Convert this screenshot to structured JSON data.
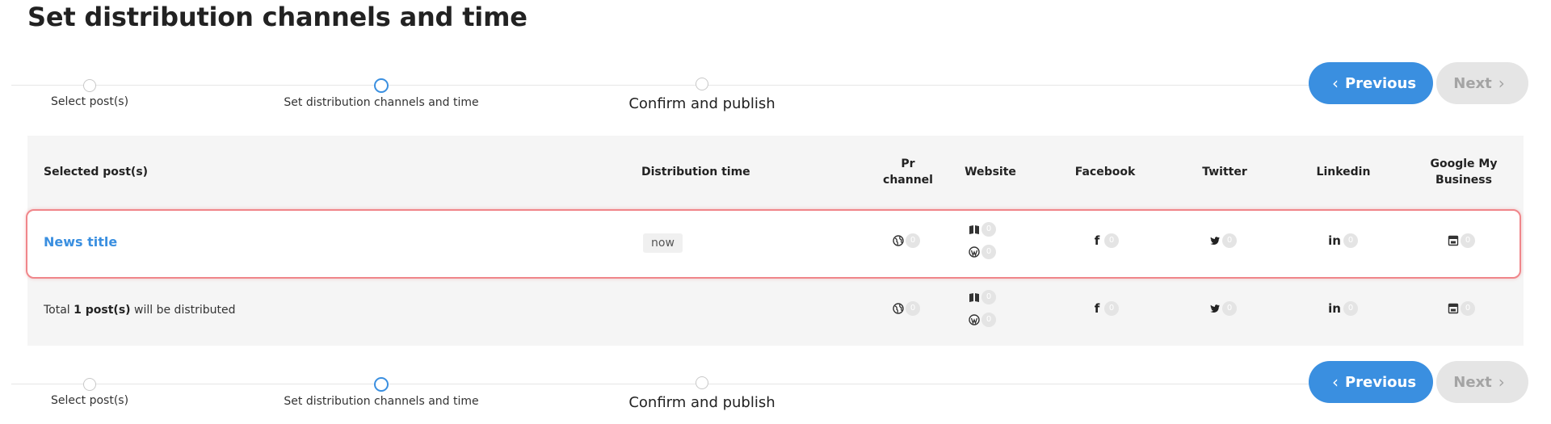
{
  "page": {
    "title": "Set distribution channels and time"
  },
  "stepper": {
    "steps": [
      {
        "label": "Select post(s)",
        "state": "default"
      },
      {
        "label": "Set distribution channels and time",
        "state": "active"
      },
      {
        "label": "Confirm and publish",
        "state": "default"
      }
    ],
    "previous_label": "Previous",
    "next_label": "Next"
  },
  "table": {
    "headers": {
      "selected_posts": "Selected post(s)",
      "distribution_time": "Distribution time",
      "pr_channel": "Pr channel",
      "website": "Website",
      "facebook": "Facebook",
      "twitter": "Twitter",
      "linkedin": "Linkedin",
      "google_my_business": "Google My Business"
    },
    "rows": [
      {
        "title": "News title",
        "distribution_time": "now",
        "counts": {
          "pr_channel": "0",
          "website_mynewsdesk": "0",
          "website_wordpress": "0",
          "facebook": "0",
          "twitter": "0",
          "linkedin": "0",
          "google_my_business": "0"
        }
      }
    ],
    "total": {
      "prefix": "Total",
      "count_text": "1 post(s)",
      "suffix": "will be distributed",
      "counts": {
        "pr_channel": "0",
        "website_mynewsdesk": "0",
        "website_wordpress": "0",
        "facebook": "0",
        "twitter": "0",
        "linkedin": "0",
        "google_my_business": "0"
      }
    }
  },
  "icons": {
    "pr_channel": "globe-icon",
    "website_mynewsdesk": "book-icon",
    "website_wordpress": "wordpress-icon",
    "facebook": "facebook-icon",
    "twitter": "twitter-icon",
    "linkedin": "linkedin-icon",
    "google_my_business": "store-icon"
  },
  "colors": {
    "primary": "#3a8fe0",
    "disabled_button": "#e5e5e5",
    "highlight_border": "#f0868a",
    "table_bg": "#f5f5f5"
  }
}
